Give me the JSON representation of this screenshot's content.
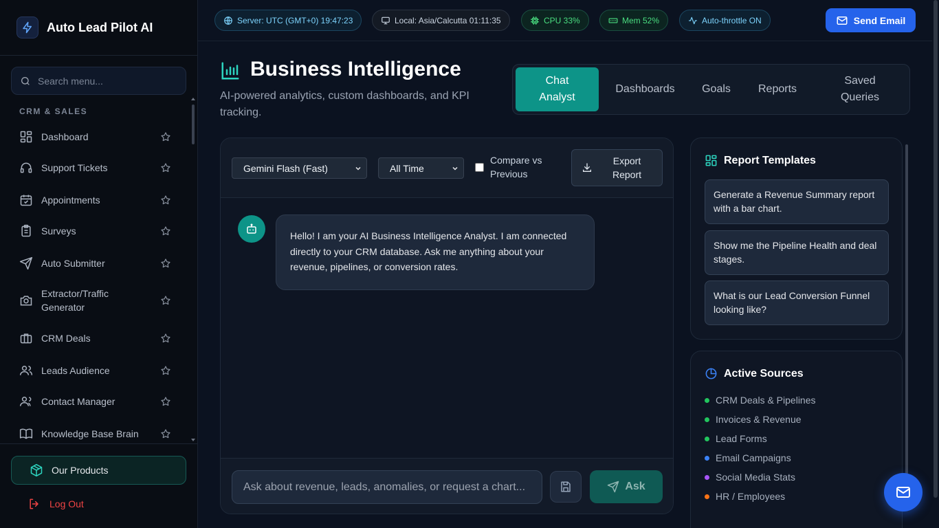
{
  "brand": {
    "title": "Auto Lead Pilot AI",
    "icon": "bolt-icon"
  },
  "sidebar": {
    "search_placeholder": "Search menu...",
    "section_label": "CRM & SALES",
    "items": [
      {
        "label": "Dashboard",
        "icon": "grid-icon"
      },
      {
        "label": "Support Tickets",
        "icon": "headset-icon"
      },
      {
        "label": "Appointments",
        "icon": "calendar-check-icon"
      },
      {
        "label": "Surveys",
        "icon": "clipboard-icon"
      },
      {
        "label": "Auto Submitter",
        "icon": "send-icon"
      },
      {
        "label": "Extractor/Traffic Generator",
        "icon": "camera-icon"
      },
      {
        "label": "CRM Deals",
        "icon": "briefcase-icon"
      },
      {
        "label": "Leads Audience",
        "icon": "users-icon"
      },
      {
        "label": "Contact Manager",
        "icon": "user-group-icon"
      },
      {
        "label": "Knowledge Base Brain",
        "icon": "book-icon"
      }
    ],
    "products_label": "Our Products",
    "logout_label": "Log Out"
  },
  "topbar": {
    "server": "Server: UTC (GMT+0) 19:47:23",
    "local": "Local: Asia/Calcutta 01:11:35",
    "cpu": "CPU 33%",
    "mem": "Mem 52%",
    "throttle": "Auto-throttle ON",
    "send_email": "Send Email"
  },
  "header": {
    "title": "Business Intelligence",
    "subtitle": "AI-powered analytics, custom dashboards, and KPI tracking."
  },
  "tabs": [
    {
      "label": "Chat Analyst",
      "active": true
    },
    {
      "label": "Dashboards",
      "active": false
    },
    {
      "label": "Goals",
      "active": false
    },
    {
      "label": "Reports",
      "active": false
    },
    {
      "label": "Saved Queries",
      "active": false
    }
  ],
  "chat": {
    "model_select": "Gemini Flash (Fast)",
    "range_select": "All Time",
    "compare_label": "Compare vs Previous",
    "compare_checked": false,
    "export_label": "Export Report",
    "welcome_message": "Hello! I am your AI Business Intelligence Analyst. I am connected directly to your CRM database. Ask me anything about your revenue, pipelines, or conversion rates.",
    "input_placeholder": "Ask about revenue, leads, anomalies, or request a chart...",
    "ask_label": "Ask"
  },
  "templates": {
    "title": "Report Templates",
    "items": [
      "Generate a Revenue Summary report with a bar chart.",
      "Show me the Pipeline Health and deal stages.",
      "What is our Lead Conversion Funnel looking like?"
    ]
  },
  "sources": {
    "title": "Active Sources",
    "items": [
      {
        "label": "CRM Deals & Pipelines",
        "color": "#22c55e"
      },
      {
        "label": "Invoices & Revenue",
        "color": "#22c55e"
      },
      {
        "label": "Lead Forms",
        "color": "#22c55e"
      },
      {
        "label": "Email Campaigns",
        "color": "#3b82f6"
      },
      {
        "label": "Social Media Stats",
        "color": "#a855f7"
      },
      {
        "label": "HR / Employees",
        "color": "#f97316"
      }
    ]
  },
  "colors": {
    "accent": "#0d9488",
    "primary": "#2563eb",
    "danger": "#ef4444"
  }
}
